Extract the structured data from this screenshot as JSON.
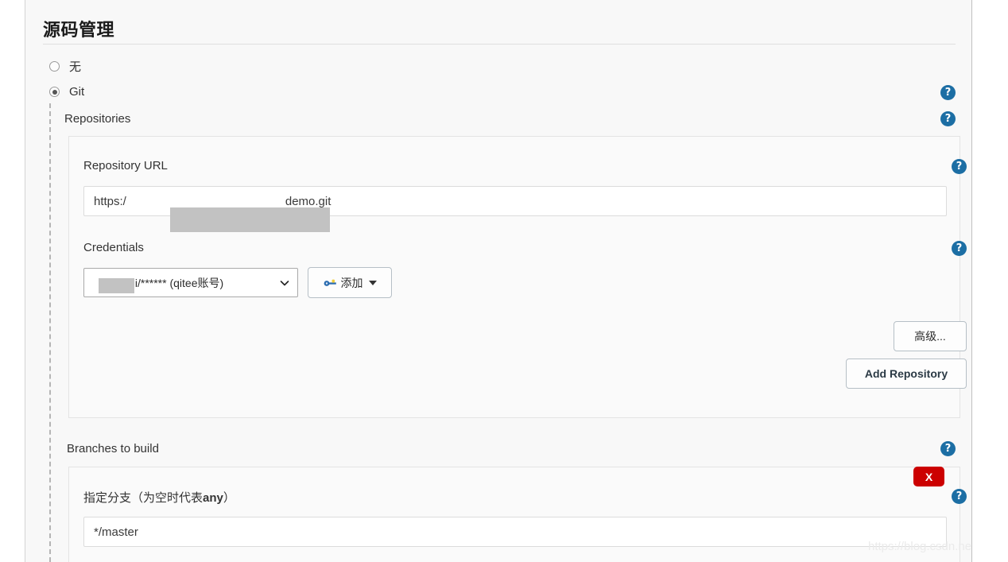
{
  "section": {
    "title": "源码管理"
  },
  "scm_options": [
    {
      "label": "无",
      "selected": false
    },
    {
      "label": "Git",
      "selected": true
    }
  ],
  "groups": {
    "repositories_label": "Repositories",
    "branches_label": "Branches to build"
  },
  "repository": {
    "url_label": "Repository URL",
    "url_value_prefix": "https:/",
    "url_value_suffix": "demo.git",
    "credentials_label": "Credentials",
    "credentials_value": ",i/****** (qitee账号)",
    "add_credential_label": "添加",
    "advanced_label": "高级...",
    "add_repository_label": "Add Repository"
  },
  "branches": {
    "spec_label_prefix": "指定分支（为空时代表",
    "spec_label_bold": "any",
    "spec_label_suffix": "）",
    "branch_value": "*/master",
    "delete_label": "X"
  },
  "icons": {
    "help": "?",
    "key": "key-icon",
    "chevron": "chevron-down-icon"
  },
  "colors": {
    "help_blue": "#1c6ea4",
    "delete_red": "#cc0000",
    "panel_bg": "#fafafa",
    "page_bg": "#f8f8f8"
  },
  "watermark": {
    "text": "https://blog.csdn.net/Ber_Bai"
  }
}
